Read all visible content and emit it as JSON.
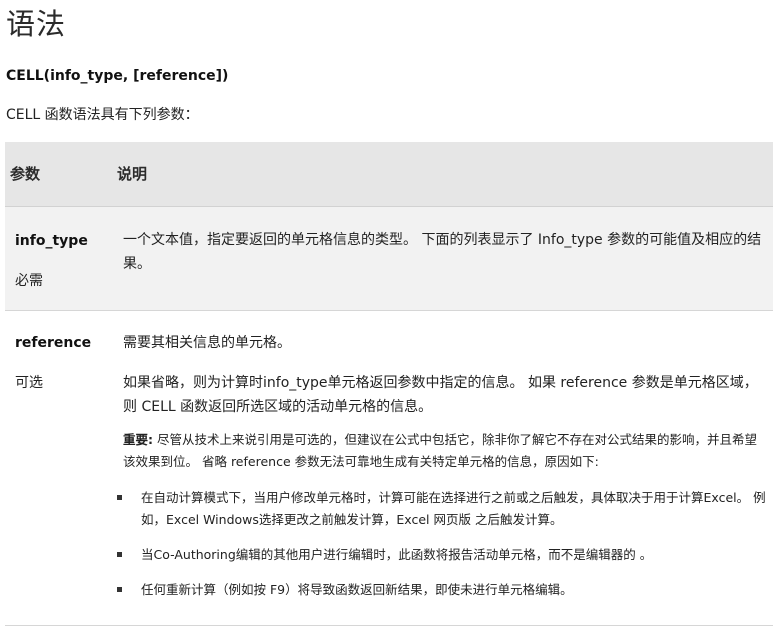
{
  "heading": "语法",
  "syntax": "CELL(info_type, [reference])",
  "intro": "CELL 函数语法具有下列参数：",
  "table": {
    "headers": {
      "param": "参数",
      "desc": "说明"
    },
    "rows": [
      {
        "name": "info_type",
        "requirement": "必需",
        "description": "一个文本值，指定要返回的单元格信息的类型。 下面的列表显示了 Info_type 参数的可能值及相应的结果。"
      },
      {
        "name": "reference",
        "requirement": "可选",
        "description_1": "需要其相关信息的单元格。",
        "description_2": "如果省略，则为计算时info_type单元格返回参数中指定的信息。 如果 reference 参数是单元格区域，则 CELL 函数返回所选区域的活动单元格的信息。",
        "note_label": "重要:",
        "note_text": " 尽管从技术上来说引用是可选的，但建议在公式中包括它，除非你了解它不存在对公式结果的影响，并且希望该效果到位。 省略 reference 参数无法可靠地生成有关特定单元格的信息，原因如下:",
        "bullets": [
          "在自动计算模式下，当用户修改单元格时，计算可能在选择进行之前或之后触发，具体取决于用于计算Excel。 例如，Excel Windows选择更改之前触发计算，Excel 网页版 之后触发计算。",
          "当Co-Authoring编辑的其他用户进行编辑时，此函数将报告活动单元格，而不是编辑器的 。",
          "任何重新计算（例如按 F9）将导致函数返回新结果，即使未进行单元格编辑。"
        ]
      }
    ]
  }
}
